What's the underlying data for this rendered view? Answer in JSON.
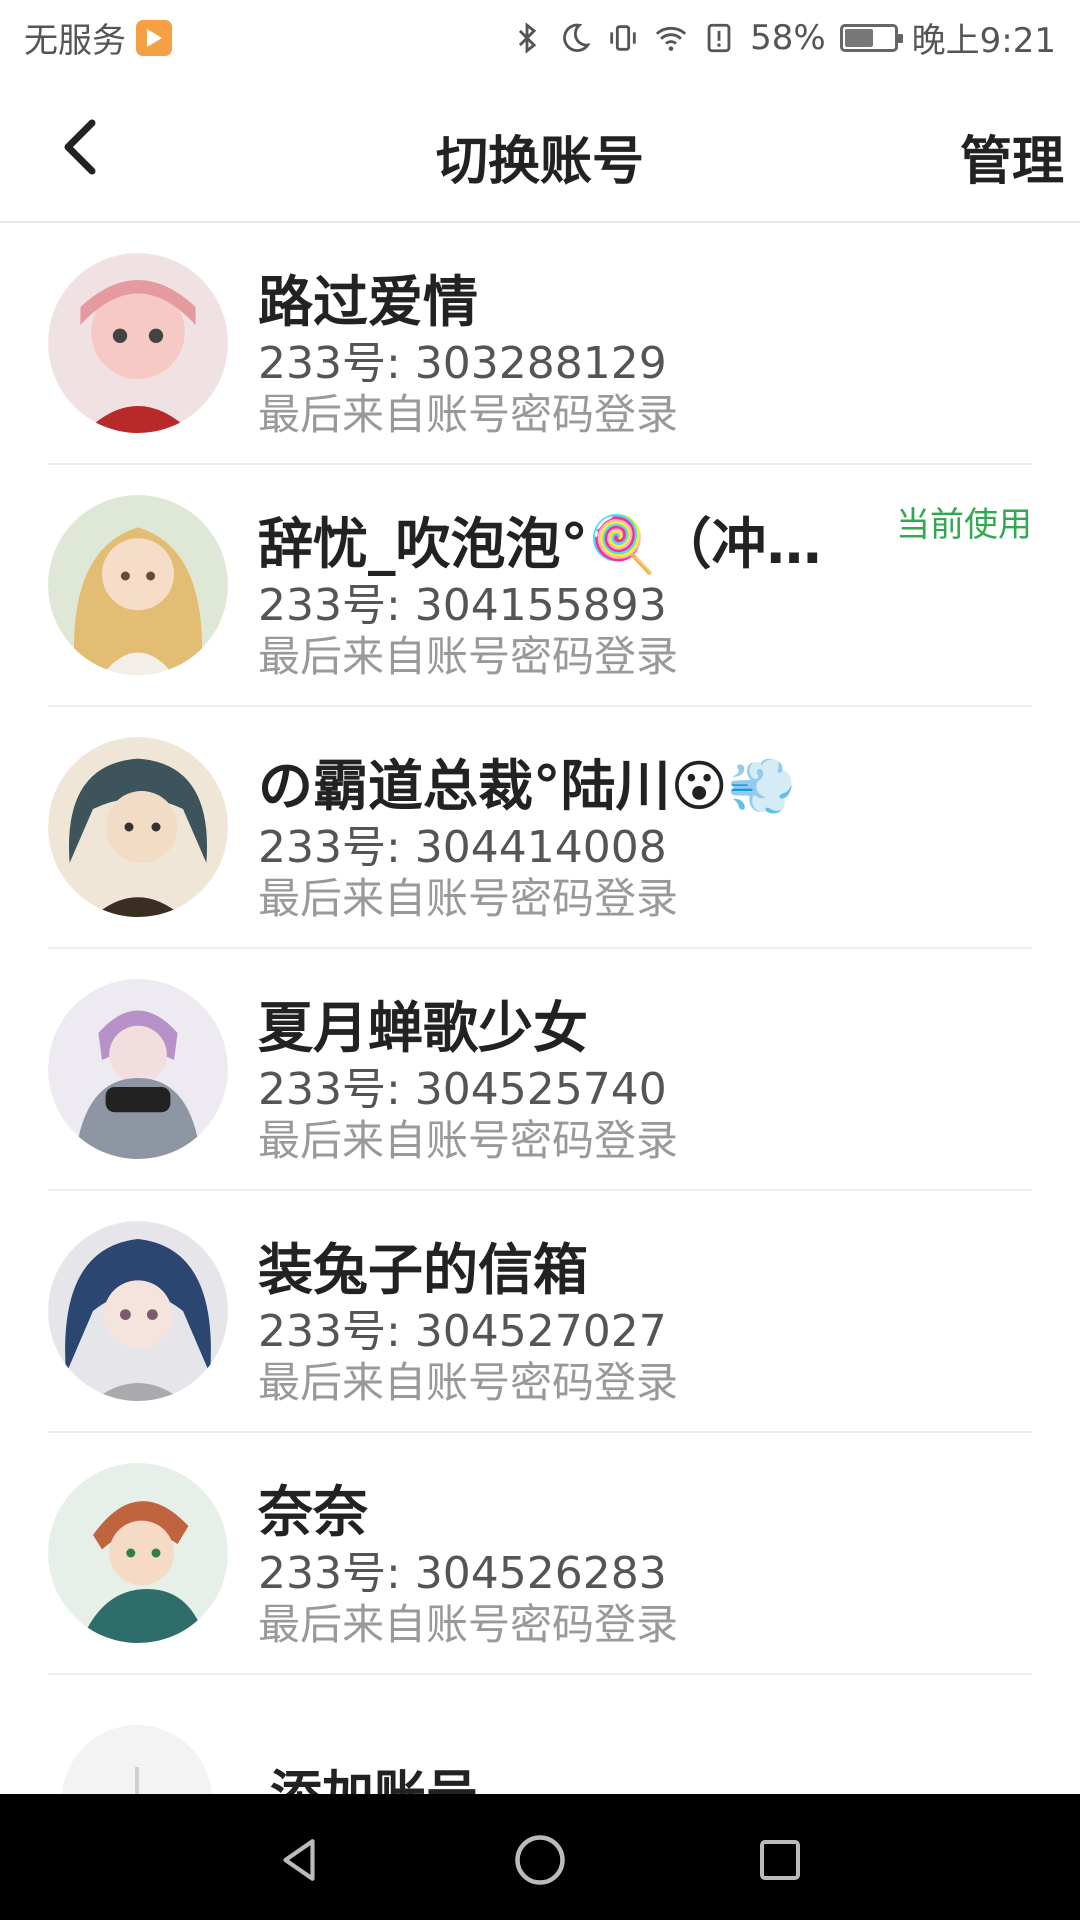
{
  "status_bar": {
    "carrier": "无服务",
    "battery": "58%",
    "time": "晚上9:21",
    "icons": [
      "bluetooth-icon",
      "moon-icon",
      "vibrate-icon",
      "wifi-icon",
      "alert-icon",
      "battery-icon"
    ]
  },
  "header": {
    "title": "切换账号",
    "manage_label": "管理",
    "back_icon": "chevron-left-icon"
  },
  "accounts": [
    {
      "name": "路过爱情",
      "uid": "233号: 303288129",
      "login": "最后来自账号密码登录",
      "current": "",
      "avatar_color": "#e7a6a6"
    },
    {
      "name": "辞忧_吹泡泡°🍭（冲…",
      "uid": "233号: 304155893",
      "login": "最后来自账号密码登录",
      "current": "当前使用",
      "avatar_color": "#e8c77a"
    },
    {
      "name": "の霸道总裁°陆川😮💨",
      "uid": "233号: 304414008",
      "login": "最后来自账号密码登录",
      "current": "",
      "avatar_color": "#5b6f74"
    },
    {
      "name": "夏月蝉歌少女",
      "uid": "233号: 304525740",
      "login": "最后来自账号密码登录",
      "current": "",
      "avatar_color": "#b8a7c8"
    },
    {
      "name": "装兔子的信箱",
      "uid": "233号: 304527027",
      "login": "最后来自账号密码登录",
      "current": "",
      "avatar_color": "#2f4b7a"
    },
    {
      "name": "奈奈",
      "uid": "233号: 304526283",
      "login": "最后来自账号密码登录",
      "current": "",
      "avatar_color": "#c36d4c"
    }
  ],
  "add_account": {
    "label": "添加账号"
  },
  "nav_bar": {
    "back_icon": "triangle-back-icon",
    "home_icon": "circle-home-icon",
    "recents_icon": "square-recents-icon"
  }
}
